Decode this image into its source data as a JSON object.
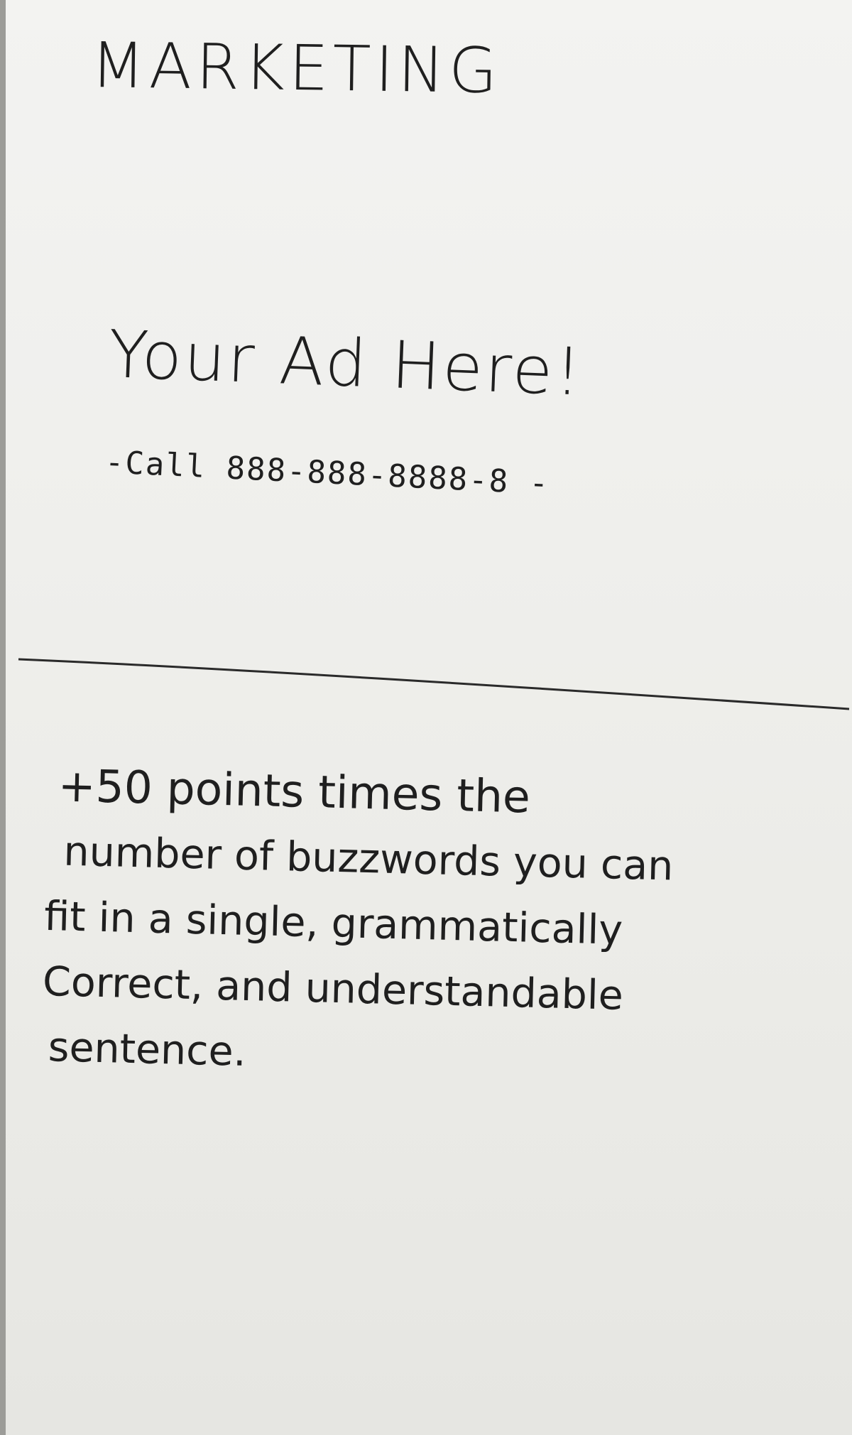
{
  "card": {
    "title": "MARKETING",
    "ad": {
      "heading": "Your Ad Here!",
      "call_line": "-Call 888-888-8888-8 -"
    },
    "rule_lines": [
      "+50 points times the",
      "number of buzzwords you can",
      "fit in a single, grammatically",
      "Correct, and understandable",
      "sentence."
    ],
    "colors": {
      "paper": "#efefec",
      "pencil": "#1f1f1f",
      "edge": "#9c9c98"
    }
  }
}
